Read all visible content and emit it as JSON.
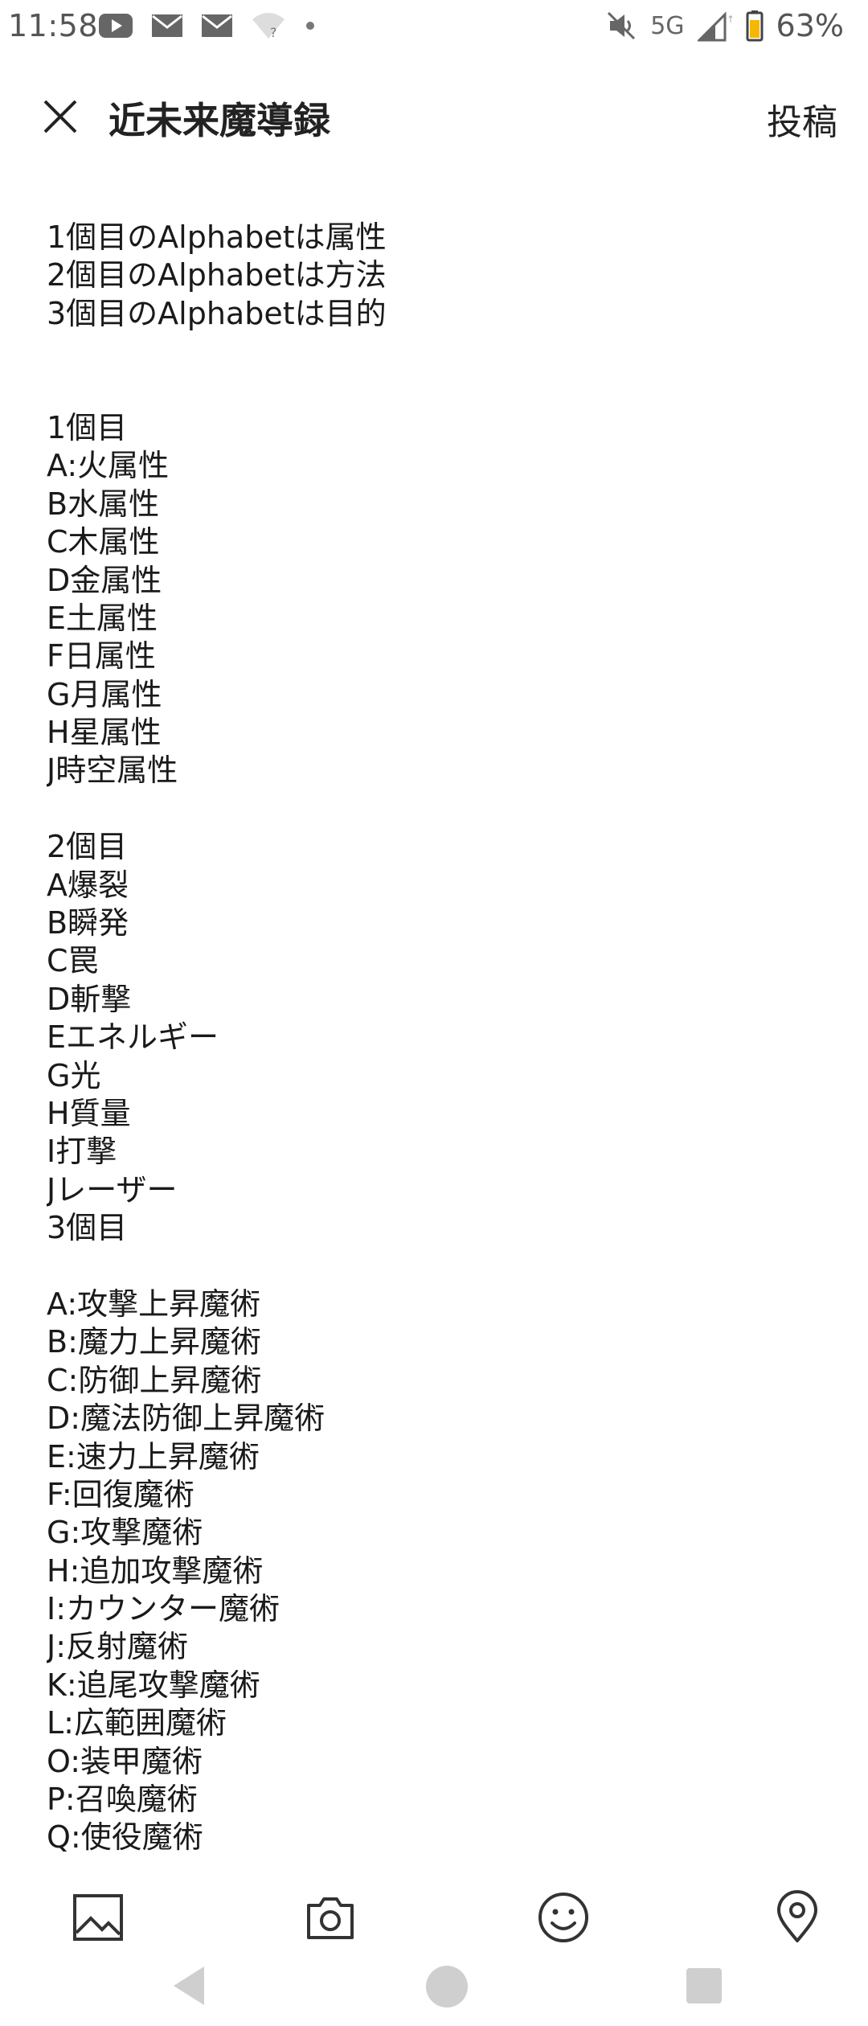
{
  "status_bar": {
    "time": "11:58",
    "network": "5G",
    "battery": "63%",
    "icons": [
      "youtube-icon",
      "mail-icon",
      "mail-icon",
      "wifi-unknown-icon",
      "dot-icon",
      "mute-icon",
      "signal-icon",
      "battery-icon"
    ]
  },
  "app_bar": {
    "title": "近未来魔導録",
    "post_label": "投稿",
    "close_icon": "close-icon"
  },
  "content": {
    "lines": [
      "1個目のAlphabetは属性",
      "2個目のAlphabetは方法",
      "3個目のAlphabetは目的",
      "",
      "",
      "1個目",
      "A:火属性",
      "B水属性",
      "C木属性",
      "D金属性",
      "E土属性",
      "F日属性",
      "G月属性",
      "H星属性",
      "J時空属性",
      "",
      "2個目",
      "A爆裂",
      "B瞬発",
      "C罠",
      "D斬撃",
      "Eエネルギー",
      "G光",
      "H質量",
      "I打撃",
      "Jレーザー",
      "3個目",
      "",
      "A:攻撃上昇魔術",
      "B:魔力上昇魔術",
      "C:防御上昇魔術",
      "D:魔法防御上昇魔術",
      "E:速力上昇魔術",
      "F:回復魔術",
      "G:攻撃魔術",
      "H:追加攻撃魔術",
      "I:カウンター魔術",
      "J:反射魔術",
      "K:追尾攻撃魔術",
      "L:広範囲魔術",
      "O:装甲魔術",
      "P:召喚魔術",
      "Q:使役魔術"
    ]
  },
  "toolbar": {
    "icons": [
      "image-icon",
      "camera-icon",
      "emoji-icon",
      "location-pin-icon"
    ]
  },
  "nav_bar": {
    "icons": [
      "back-icon",
      "home-icon",
      "recents-icon"
    ]
  },
  "colors": {
    "background": "#ffffff",
    "text": "#1a1a1a",
    "icon": "#333333",
    "nav": "#cfcfcf",
    "battery_accent": "#f5b800"
  }
}
